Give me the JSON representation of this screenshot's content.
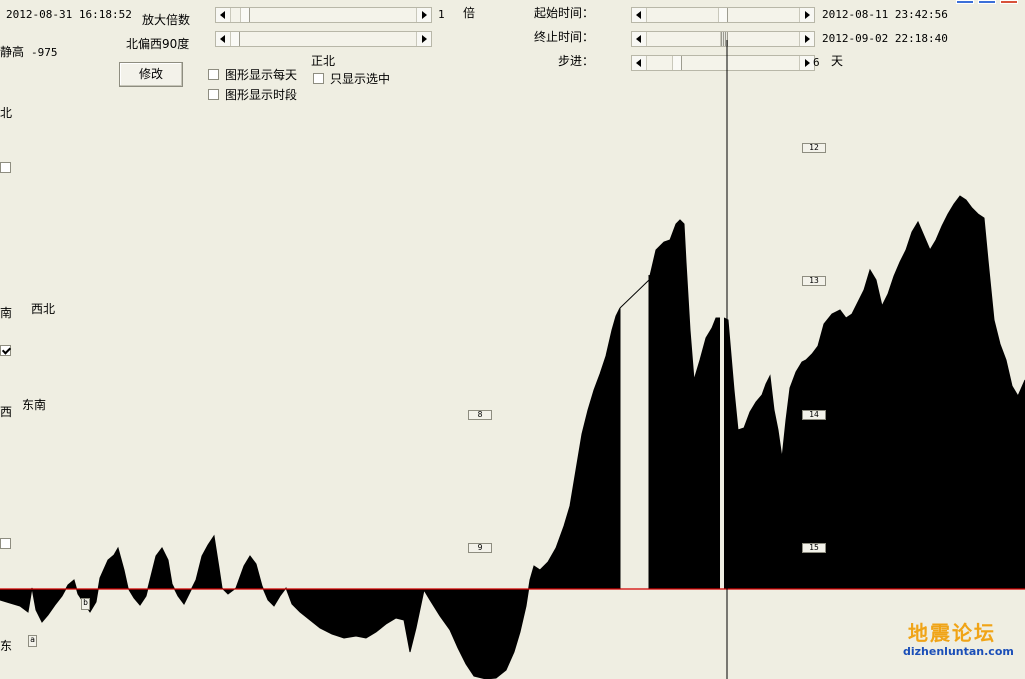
{
  "header": {
    "current_time": "2012-08-31 16:18:52",
    "zoom_label": "放大倍数",
    "zoom_value": "1",
    "zoom_unit": "倍",
    "angle_label": "北偏西90度",
    "static_height_label": "静高",
    "static_height_value": "-975",
    "modify_button": "修改",
    "show_daily_label": "图形显示每天",
    "show_period_label": "图形显示时段",
    "show_selected_label": "只显示选中",
    "true_north_label": "正北",
    "start_time_label": "起始时间：",
    "start_time_value": "2012-08-11 23:42:56",
    "end_time_label": "终止时间：",
    "end_time_value": "2012-09-02 22:18:40",
    "step_label": "步进：",
    "step_value": "6",
    "step_unit": "天"
  },
  "compass": {
    "north": "北",
    "south": "南",
    "west": "西",
    "east": "东",
    "northwest": "西北",
    "southeast": "东南"
  },
  "markers": {
    "center": [
      "8",
      "9"
    ],
    "right": [
      "12",
      "13",
      "14",
      "15"
    ],
    "small_b": "b",
    "small_a": "a"
  },
  "watermark": {
    "title": "地震论坛",
    "url": "dizhenluntan.com"
  },
  "colors": {
    "background": "#efeee2",
    "baseline": "#d40000",
    "waveform": "#000000"
  }
}
